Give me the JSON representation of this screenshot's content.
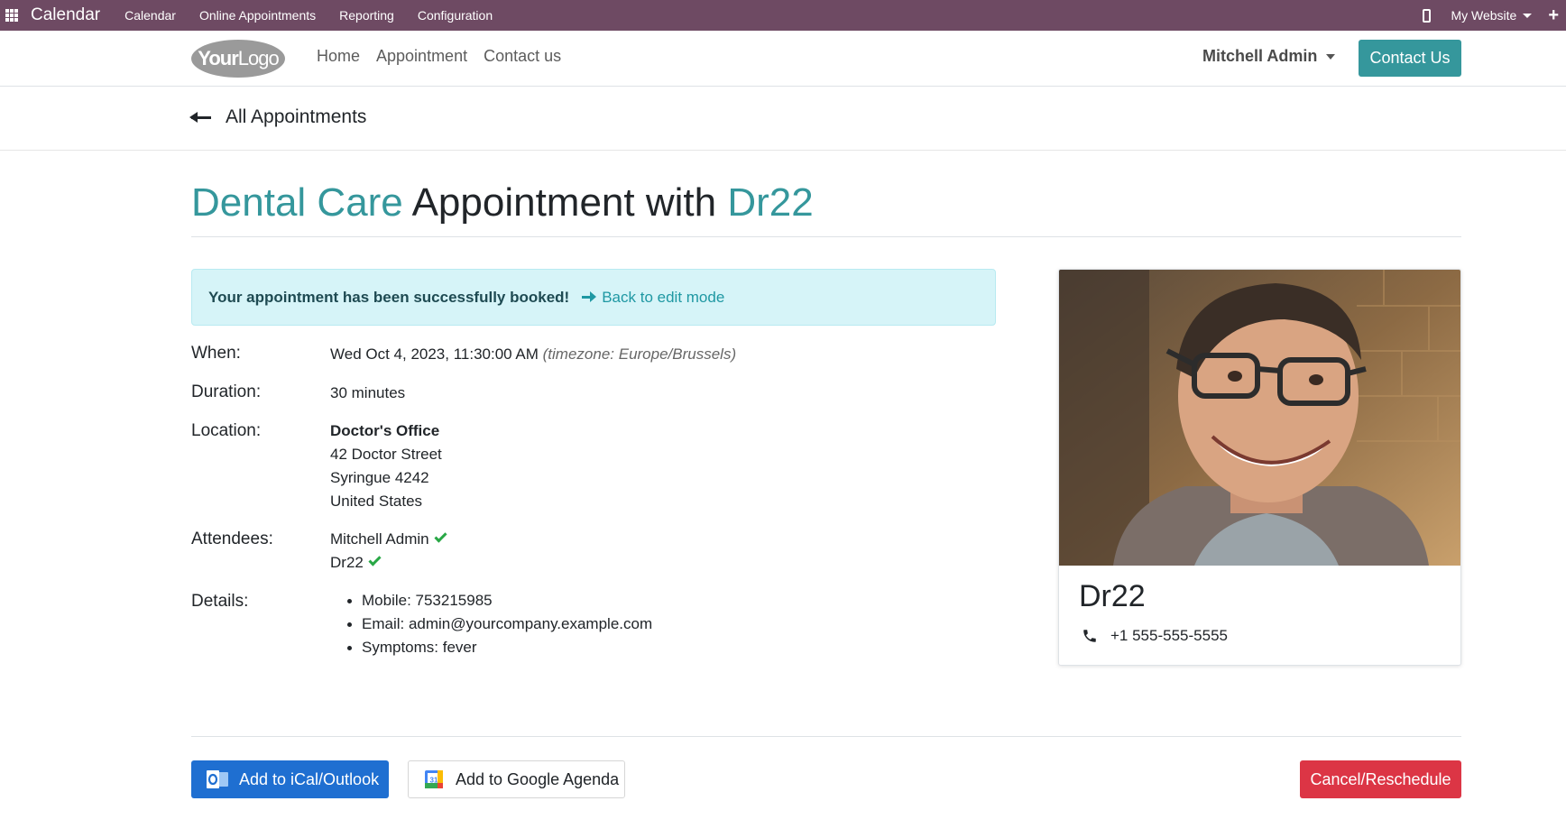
{
  "topbar": {
    "app_name": "Calendar",
    "menu": [
      "Calendar",
      "Online Appointments",
      "Reporting",
      "Configuration"
    ],
    "website_selector": "My Website",
    "plus": "+"
  },
  "header": {
    "logo_text_bold": "Your",
    "logo_text_light": "Logo",
    "nav": [
      "Home",
      "Appointment",
      "Contact us"
    ],
    "user": "Mitchell Admin",
    "cta": "Contact Us"
  },
  "back": {
    "label": "All Appointments"
  },
  "title": {
    "type": "Dental Care",
    "middle": " Appointment with ",
    "staff": "Dr22"
  },
  "alert": {
    "message": "Your appointment has been successfully booked!",
    "link": "Back to edit mode"
  },
  "details": {
    "when_label": "When:",
    "when_value": "Wed Oct 4, 2023, 11:30:00 AM",
    "timezone": "(timezone: Europe/Brussels)",
    "duration_label": "Duration:",
    "duration_value": "30 minutes",
    "location_label": "Location:",
    "location": {
      "name": "Doctor's Office",
      "street": "42 Doctor Street",
      "city": "Syringue 4242",
      "country": "United States"
    },
    "attendees_label": "Attendees:",
    "attendees": [
      "Mitchell Admin",
      "Dr22"
    ],
    "details_label": "Details:",
    "items": [
      "Mobile: 753215985",
      "Email: admin@yourcompany.example.com",
      "Symptoms: fever"
    ]
  },
  "card": {
    "name": "Dr22",
    "phone": "+1 555-555-5555"
  },
  "actions": {
    "ical": "Add to iCal/Outlook",
    "google": "Add to Google Agenda",
    "cancel": "Cancel/Reschedule"
  },
  "colors": {
    "topbar": "#6e4a63",
    "accent": "#35979c",
    "alert_bg": "#d6f4f8",
    "ical_btn": "#1f6fd1",
    "cancel_btn": "#dc3545",
    "check": "#28a745"
  }
}
